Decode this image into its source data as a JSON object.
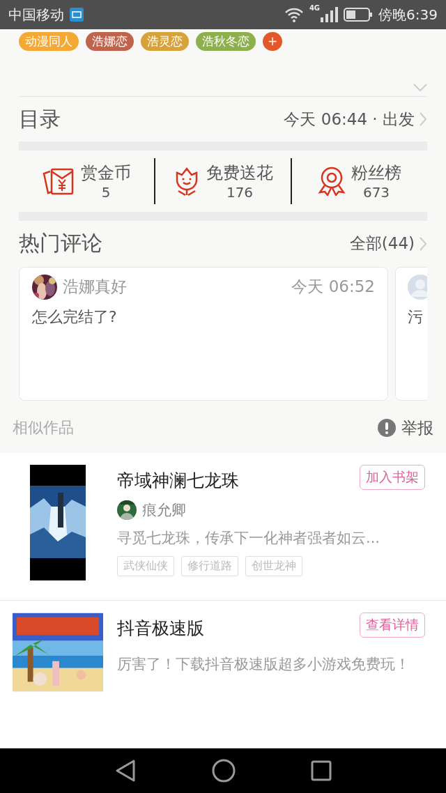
{
  "status_bar": {
    "carrier": "中国移动",
    "network": "4G",
    "time": "傍晚6:39"
  },
  "tags": [
    {
      "label": "动漫同人",
      "color": "#f5a935"
    },
    {
      "label": "浩娜恋",
      "color": "#c0634c"
    },
    {
      "label": "浩灵恋",
      "color": "#d8a23a"
    },
    {
      "label": "浩秋冬恋",
      "color": "#8db04c"
    },
    {
      "label": "+",
      "color": "#e2582a"
    }
  ],
  "catalog": {
    "title": "目录",
    "update": "今天 06:44 · 出发"
  },
  "stats": [
    {
      "kind": "reward",
      "label": "赏金币",
      "value": "5"
    },
    {
      "kind": "flower",
      "label": "免费送花",
      "value": "176"
    },
    {
      "kind": "fans",
      "label": "粉丝榜",
      "value": "673"
    }
  ],
  "comments": {
    "title": "热门评论",
    "all": "全部(44)",
    "items": [
      {
        "user": "浩娜真好",
        "time": "今天 06:52",
        "text": "怎么完结了?"
      },
      {
        "text": "污"
      }
    ]
  },
  "similar": {
    "title": "相似作品",
    "report": "举报"
  },
  "books": [
    {
      "kind": "book",
      "title": "帝域神澜七龙珠",
      "action": "加入书架",
      "author": "痕允卿",
      "summary": "寻觅七龙珠，传承下一化神者强者如云...",
      "tags": [
        "武侠仙侠",
        "修行道路",
        "创世龙神"
      ]
    },
    {
      "kind": "ad",
      "title": "抖音极速版",
      "action": "查看详情",
      "summary": "厉害了！下载抖音极速版超多小游戏免费玩！"
    }
  ]
}
